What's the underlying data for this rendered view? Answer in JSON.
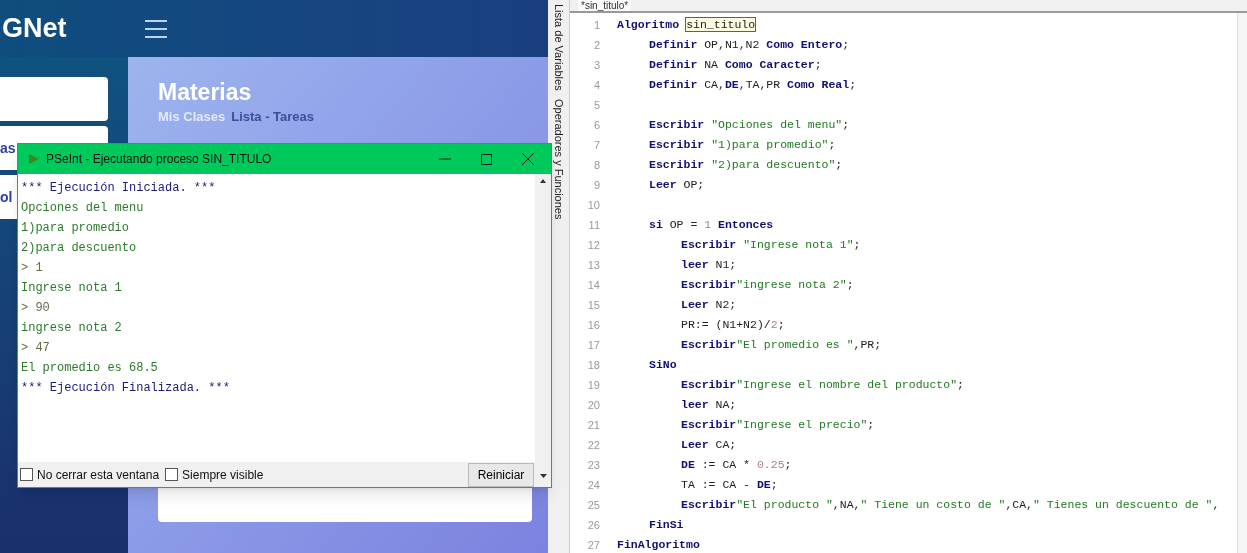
{
  "web_page": {
    "logo": "GNet",
    "sidebar_items": [
      {
        "label": "as"
      },
      {
        "label": "ol"
      }
    ],
    "page_title": "Materias",
    "breadcrumb": [
      {
        "label": "Mis Clases",
        "selected": false
      },
      {
        "label": "Lista - Tareas",
        "selected": true
      }
    ]
  },
  "console_window": {
    "title": "PSeInt - Ejecutando proceso SIN_TITULO",
    "lines": [
      {
        "kind": "system",
        "text": "*** Ejecución Iniciada. ***"
      },
      {
        "kind": "output",
        "text": "Opciones del menu"
      },
      {
        "kind": "output",
        "text": "1)para promedio"
      },
      {
        "kind": "output",
        "text": "2)para descuento"
      },
      {
        "kind": "input",
        "text": "> 1"
      },
      {
        "kind": "output",
        "text": "Ingrese nota 1"
      },
      {
        "kind": "input",
        "text": "> 90"
      },
      {
        "kind": "output",
        "text": "ingrese nota 2"
      },
      {
        "kind": "input",
        "text": "> 47"
      },
      {
        "kind": "output",
        "text": "El promedio es 68.5"
      },
      {
        "kind": "system",
        "text": "*** Ejecución Finalizada. ***"
      }
    ],
    "options": [
      {
        "label": "No cerrar esta ventana",
        "checked": false
      },
      {
        "label": "Siempre visible",
        "checked": false
      }
    ],
    "restart_button": "Reiniciar"
  },
  "editor": {
    "tab": "*sin_titulo*",
    "side_panels": [
      "Lista de Variables",
      "Operadores y Funciones"
    ],
    "lines": [
      {
        "number": "1",
        "tokens": [
          {
            "kind": "keyword",
            "text": "Algoritmo"
          },
          {
            "kind": "match",
            "text": "sin_titulo"
          }
        ],
        "children": [
          {
            "number": "2",
            "tokens": [
              {
                "kind": "keyword",
                "text": "Definir"
              },
              {
                "kind": "plain",
                "text": " OP,N1,N2 "
              },
              {
                "kind": "keyword",
                "text": "Como Entero"
              },
              {
                "kind": "plain",
                "text": ";"
              }
            ]
          },
          {
            "number": "3",
            "tokens": [
              {
                "kind": "keyword",
                "text": "Definir"
              },
              {
                "kind": "plain",
                "text": " NA "
              },
              {
                "kind": "keyword",
                "text": "Como Caracter"
              },
              {
                "kind": "plain",
                "text": ";"
              }
            ]
          },
          {
            "number": "4",
            "tokens": [
              {
                "kind": "keyword",
                "text": "Definir"
              },
              {
                "kind": "plain",
                "text": " CA,"
              },
              {
                "kind": "keyword",
                "text": "DE"
              },
              {
                "kind": "plain",
                "text": ",TA,PR "
              },
              {
                "kind": "keyword",
                "text": "Como Real"
              },
              {
                "kind": "plain",
                "text": ";"
              }
            ]
          },
          {
            "number": "5"
          },
          {
            "number": "6",
            "tokens": [
              {
                "kind": "keyword",
                "text": "Escribir "
              },
              {
                "kind": "string",
                "text": "\"Opciones del menu\""
              },
              {
                "kind": "plain",
                "text": ";"
              }
            ]
          },
          {
            "number": "7",
            "tokens": [
              {
                "kind": "keyword",
                "text": "Escribir "
              },
              {
                "kind": "string",
                "text": "\"1)para promedio\""
              },
              {
                "kind": "plain",
                "text": ";"
              }
            ]
          },
          {
            "number": "8",
            "tokens": [
              {
                "kind": "keyword",
                "text": "Escribir "
              },
              {
                "kind": "string",
                "text": "\"2)para descuento\""
              },
              {
                "kind": "plain",
                "text": ";"
              }
            ]
          },
          {
            "number": "9",
            "tokens": [
              {
                "kind": "keyword",
                "text": "Leer"
              },
              {
                "kind": "plain",
                "text": " OP;"
              }
            ]
          },
          {
            "number": "10"
          },
          {
            "number": "11",
            "tokens": [
              {
                "kind": "keyword",
                "text": "si"
              },
              {
                "kind": "plain",
                "text": " OP = "
              },
              {
                "kind": "number",
                "text": "1"
              },
              {
                "kind": "keyword",
                "text": " Entonces"
              }
            ],
            "children": [
              {
                "number": "12",
                "tokens": [
                  {
                    "kind": "keyword",
                    "text": "Escribir "
                  },
                  {
                    "kind": "string",
                    "text": "\"Ingrese nota 1\""
                  },
                  {
                    "kind": "plain",
                    "text": ";"
                  }
                ]
              },
              {
                "number": "13",
                "tokens": [
                  {
                    "kind": "keyword",
                    "text": "leer"
                  },
                  {
                    "kind": "plain",
                    "text": " N1;"
                  }
                ]
              },
              {
                "number": "14",
                "tokens": [
                  {
                    "kind": "keyword",
                    "text": "Escribir"
                  },
                  {
                    "kind": "string",
                    "text": "\"ingrese nota 2\""
                  },
                  {
                    "kind": "plain",
                    "text": ";"
                  }
                ]
              },
              {
                "number": "15",
                "tokens": [
                  {
                    "kind": "keyword",
                    "text": "Leer"
                  },
                  {
                    "kind": "plain",
                    "text": " N2;"
                  }
                ]
              },
              {
                "number": "16",
                "tokens": [
                  {
                    "kind": "plain",
                    "text": "PR:= (N1+N2)/"
                  },
                  {
                    "kind": "number",
                    "text": "2"
                  },
                  {
                    "kind": "plain",
                    "text": ";"
                  }
                ]
              },
              {
                "number": "17",
                "tokens": [
                  {
                    "kind": "keyword",
                    "text": "Escribir"
                  },
                  {
                    "kind": "string",
                    "text": "\"El promedio es \""
                  },
                  {
                    "kind": "plain",
                    "text": ",PR;"
                  }
                ]
              }
            ]
          },
          {
            "number": "18",
            "tokens": [
              {
                "kind": "keyword",
                "text": "SiNo"
              }
            ],
            "children": [
              {
                "number": "19",
                "tokens": [
                  {
                    "kind": "keyword",
                    "text": "Escribir"
                  },
                  {
                    "kind": "string",
                    "text": "\"Ingrese el nombre del producto\""
                  },
                  {
                    "kind": "plain",
                    "text": ";"
                  }
                ]
              },
              {
                "number": "20",
                "tokens": [
                  {
                    "kind": "keyword",
                    "text": "leer"
                  },
                  {
                    "kind": "plain",
                    "text": " NA;"
                  }
                ]
              },
              {
                "number": "21",
                "tokens": [
                  {
                    "kind": "keyword",
                    "text": "Escribir"
                  },
                  {
                    "kind": "string",
                    "text": "\"Ingrese el precio\""
                  },
                  {
                    "kind": "plain",
                    "text": ";"
                  }
                ]
              },
              {
                "number": "22",
                "tokens": [
                  {
                    "kind": "keyword",
                    "text": "Leer"
                  },
                  {
                    "kind": "plain",
                    "text": " CA;"
                  }
                ]
              },
              {
                "number": "23",
                "tokens": [
                  {
                    "kind": "keyword",
                    "text": "DE"
                  },
                  {
                    "kind": "plain",
                    "text": " := CA * "
                  },
                  {
                    "kind": "number",
                    "text": "0.25"
                  },
                  {
                    "kind": "plain",
                    "text": ";"
                  }
                ]
              },
              {
                "number": "24",
                "tokens": [
                  {
                    "kind": "plain",
                    "text": "TA := CA - "
                  },
                  {
                    "kind": "keyword",
                    "text": "DE"
                  },
                  {
                    "kind": "plain",
                    "text": ";"
                  }
                ]
              },
              {
                "number": "25",
                "tokens": [
                  {
                    "kind": "keyword",
                    "text": "Escribir"
                  },
                  {
                    "kind": "string",
                    "text": "\"El producto \""
                  },
                  {
                    "kind": "plain",
                    "text": ",NA,"
                  },
                  {
                    "kind": "string",
                    "text": "\" Tiene un costo de \""
                  },
                  {
                    "kind": "plain",
                    "text": ",CA,"
                  },
                  {
                    "kind": "string",
                    "text": "\" Tienes un descuento de \""
                  },
                  {
                    "kind": "plain",
                    "text": ","
                  }
                ]
              }
            ]
          },
          {
            "number": "26",
            "tokens": [
              {
                "kind": "keyword",
                "text": "FinSi"
              }
            ]
          }
        ]
      },
      {
        "number": "27",
        "tokens": [
          {
            "kind": "keyword",
            "text": "FinAlgoritmo"
          }
        ]
      }
    ]
  }
}
